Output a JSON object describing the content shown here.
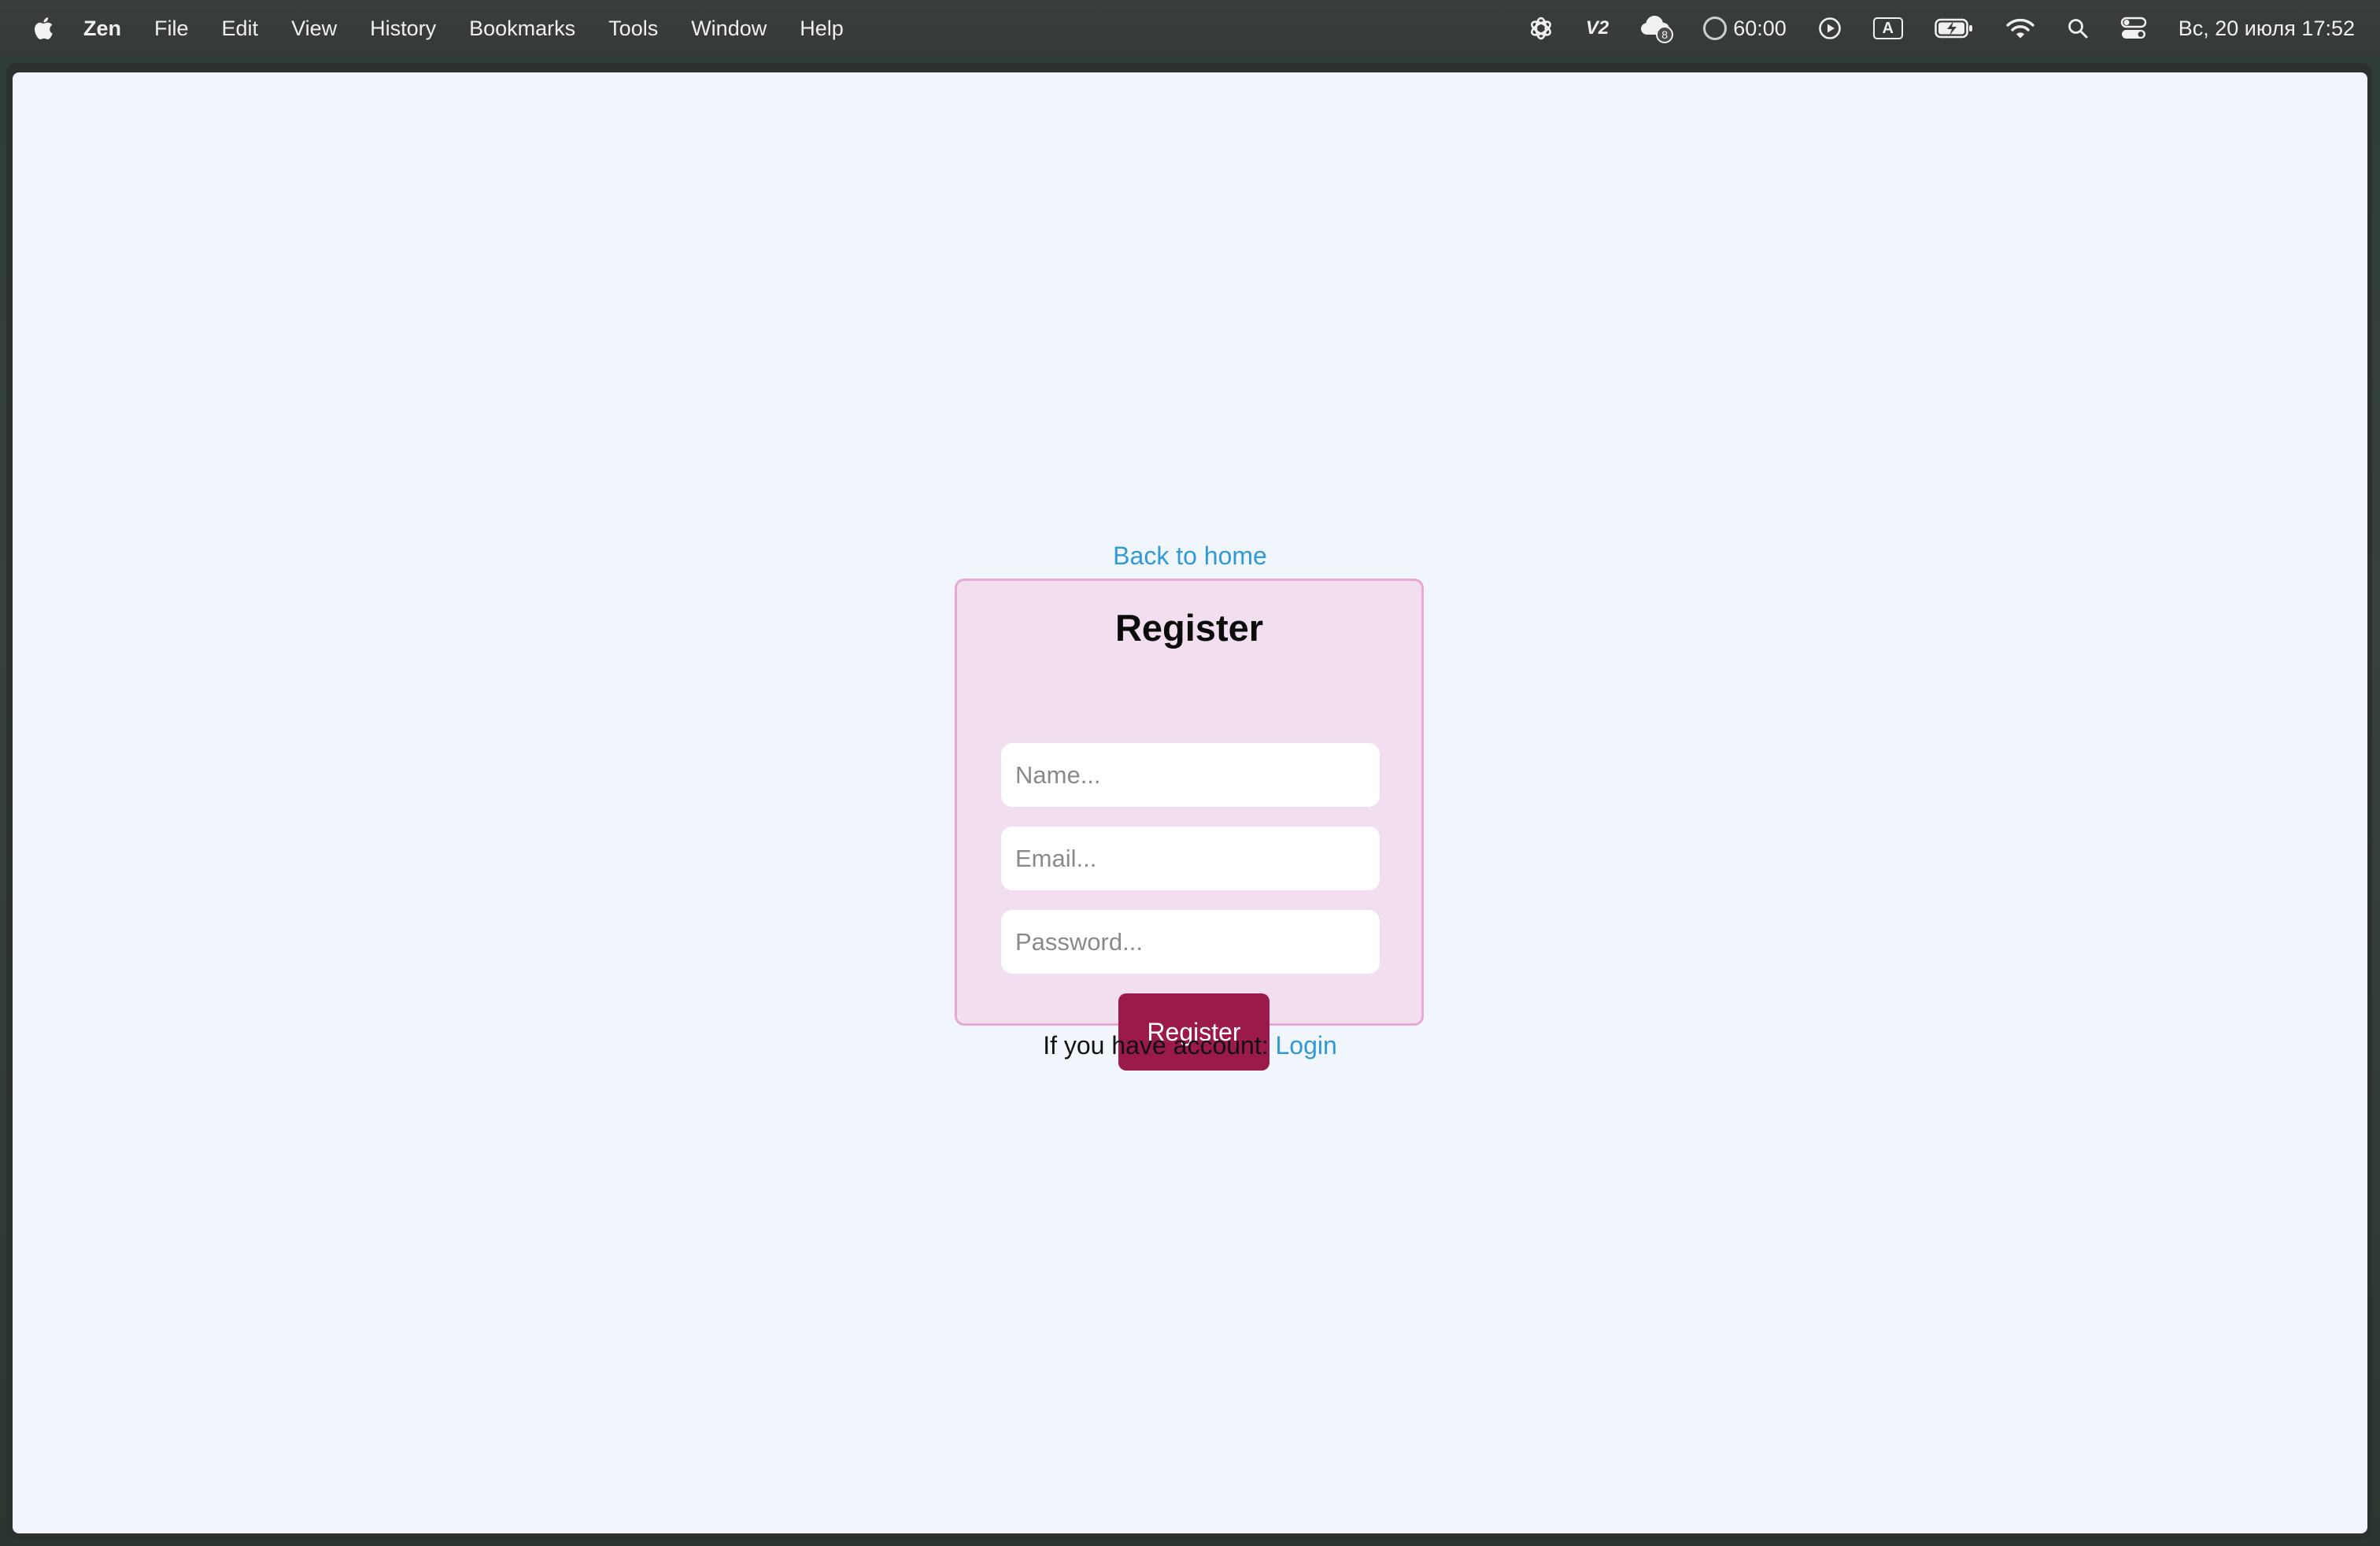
{
  "menubar": {
    "app_name": "Zen",
    "items": [
      "File",
      "Edit",
      "View",
      "History",
      "Bookmarks",
      "Tools",
      "Window",
      "Help"
    ],
    "tray": {
      "v2_label": "V2",
      "badge_count": "8",
      "timer": "60:00",
      "input_source": "A",
      "datetime": "Вс, 20 июля  17:52"
    }
  },
  "page": {
    "back_link": "Back to home",
    "title": "Register",
    "fields": {
      "name_placeholder": "Name...",
      "email_placeholder": "Email...",
      "password_placeholder": "Password..."
    },
    "submit_label": "Register",
    "footer_text": "If you have account: ",
    "login_link": "Login"
  },
  "colors": {
    "page_background": "#f1f6fd",
    "card_background": "#f1dff0",
    "card_border": "#e7a8d4",
    "button": "#9b1a4b",
    "link": "#3199d6"
  }
}
